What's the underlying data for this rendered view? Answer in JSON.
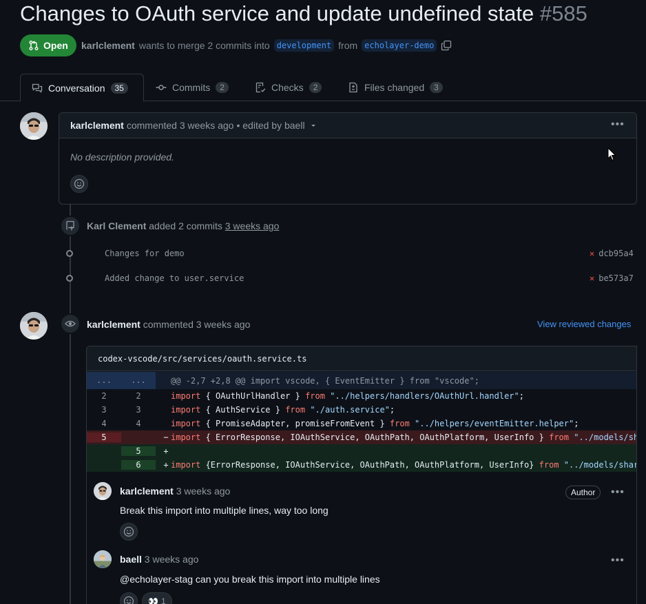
{
  "pr": {
    "title": "Changes to OAuth service and update undefined state",
    "number": "#585",
    "state": "Open",
    "author": "karlclement",
    "merge_text": "wants to merge 2 commits into",
    "base_branch": "development",
    "from_text": "from",
    "head_branch": "echolayer-demo"
  },
  "tabs": [
    {
      "label": "Conversation",
      "count": "35"
    },
    {
      "label": "Commits",
      "count": "2"
    },
    {
      "label": "Checks",
      "count": "2"
    },
    {
      "label": "Files changed",
      "count": "3"
    }
  ],
  "first_comment": {
    "author": "karlclement",
    "action": "commented 3 weeks ago",
    "edited": "• edited by baell",
    "body": "No description provided."
  },
  "commits_event": {
    "actor": "Karl Clement",
    "action": "added 2 commits",
    "time": "3 weeks ago",
    "commits": [
      {
        "message": "Changes for demo",
        "sha": "dcb95a4"
      },
      {
        "message": "Added change to user.service",
        "sha": "be573a7"
      }
    ]
  },
  "review": {
    "author": "karlclement",
    "action": "commented 3 weeks ago",
    "view_link": "View reviewed changes",
    "file": "codex-vscode/src/services/oauth.service.ts",
    "hunk": "@@ -2,7 +2,8 @@ import vscode, { EventEmitter } from \"vscode\";",
    "hunk_left": "...",
    "hunk_right": "...",
    "lines": [
      {
        "old": "2",
        "new": "2",
        "sign": "",
        "kw1": "import",
        "mid": " { OAuthUrlHandler } ",
        "kw2": "from",
        "str": " \"../helpers/handlers/OAuthUrl.handler\"",
        "tail": ";"
      },
      {
        "old": "3",
        "new": "3",
        "sign": "",
        "kw1": "import",
        "mid": " { AuthService } ",
        "kw2": "from",
        "str": " \"./auth.service\"",
        "tail": ";"
      },
      {
        "old": "4",
        "new": "4",
        "sign": "",
        "kw1": "import",
        "mid": " { PromiseAdapter, promiseFromEvent } ",
        "kw2": "from",
        "str": " \"../helpers/eventEmitter.helper\"",
        "tail": ";"
      },
      {
        "old": "5",
        "new": "",
        "sign": "−",
        "kw1": "import",
        "mid": " { ErrorResponse, IOAuthService, OAuthPath, OAuthPlatform, UserInfo } ",
        "kw2": "from",
        "str": " \"../models/sh",
        "tail": ""
      },
      {
        "old": "",
        "new": "5",
        "sign": "+",
        "kw1": "",
        "mid": "",
        "kw2": "",
        "str": "",
        "tail": ""
      },
      {
        "old": "",
        "new": "6",
        "sign": "+",
        "kw1": "import",
        "mid": " {ErrorResponse, IOAuthService, OAuthPath, OAuthPlatform, UserInfo} ",
        "kw2": "from",
        "str": " \"../models/shar",
        "tail": ""
      }
    ],
    "replies": [
      {
        "author": "karlclement",
        "time": "3 weeks ago",
        "badge": "Author",
        "body": "Break this import into multiple lines, way too long"
      },
      {
        "author": "baell",
        "time": "3 weeks ago",
        "body": "@echolayer-stag can you break this import into multiple lines",
        "reaction_count": "1"
      }
    ]
  }
}
